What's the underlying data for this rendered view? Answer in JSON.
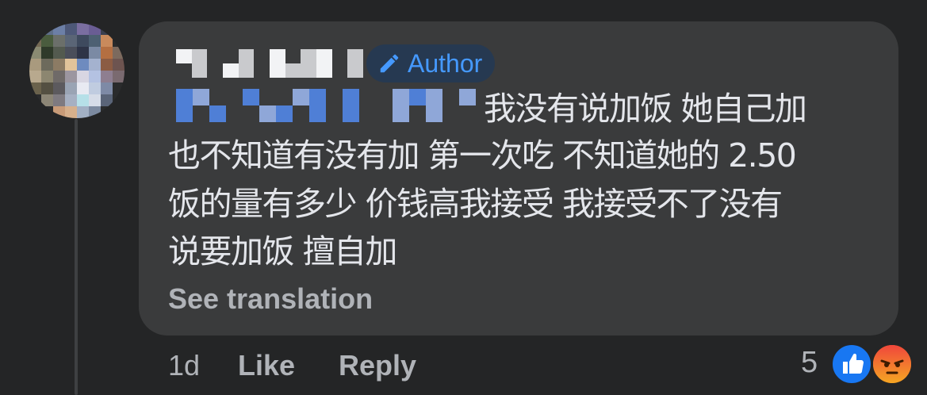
{
  "comment": {
    "author_badge": "Author",
    "text_lines": [
      "我没有说加饭 她自己加",
      "也不知道有没有加 第一次吃 不知道她的 2.50",
      "饭的量有多少 价钱高我接受 我接受不了没有",
      "说要加饭 擅自加"
    ],
    "see_translation": "See translation",
    "timestamp": "1d",
    "like_label": "Like",
    "reply_label": "Reply",
    "reaction_count": "5",
    "reactions": [
      "like-icon",
      "angry-icon"
    ],
    "colors": {
      "background": "#242526",
      "bubble": "#3a3b3c",
      "badge_text": "#4599ff",
      "muted_text": "#b0b3b8",
      "like": "#1877f2",
      "angry": "#e9710f"
    }
  }
}
